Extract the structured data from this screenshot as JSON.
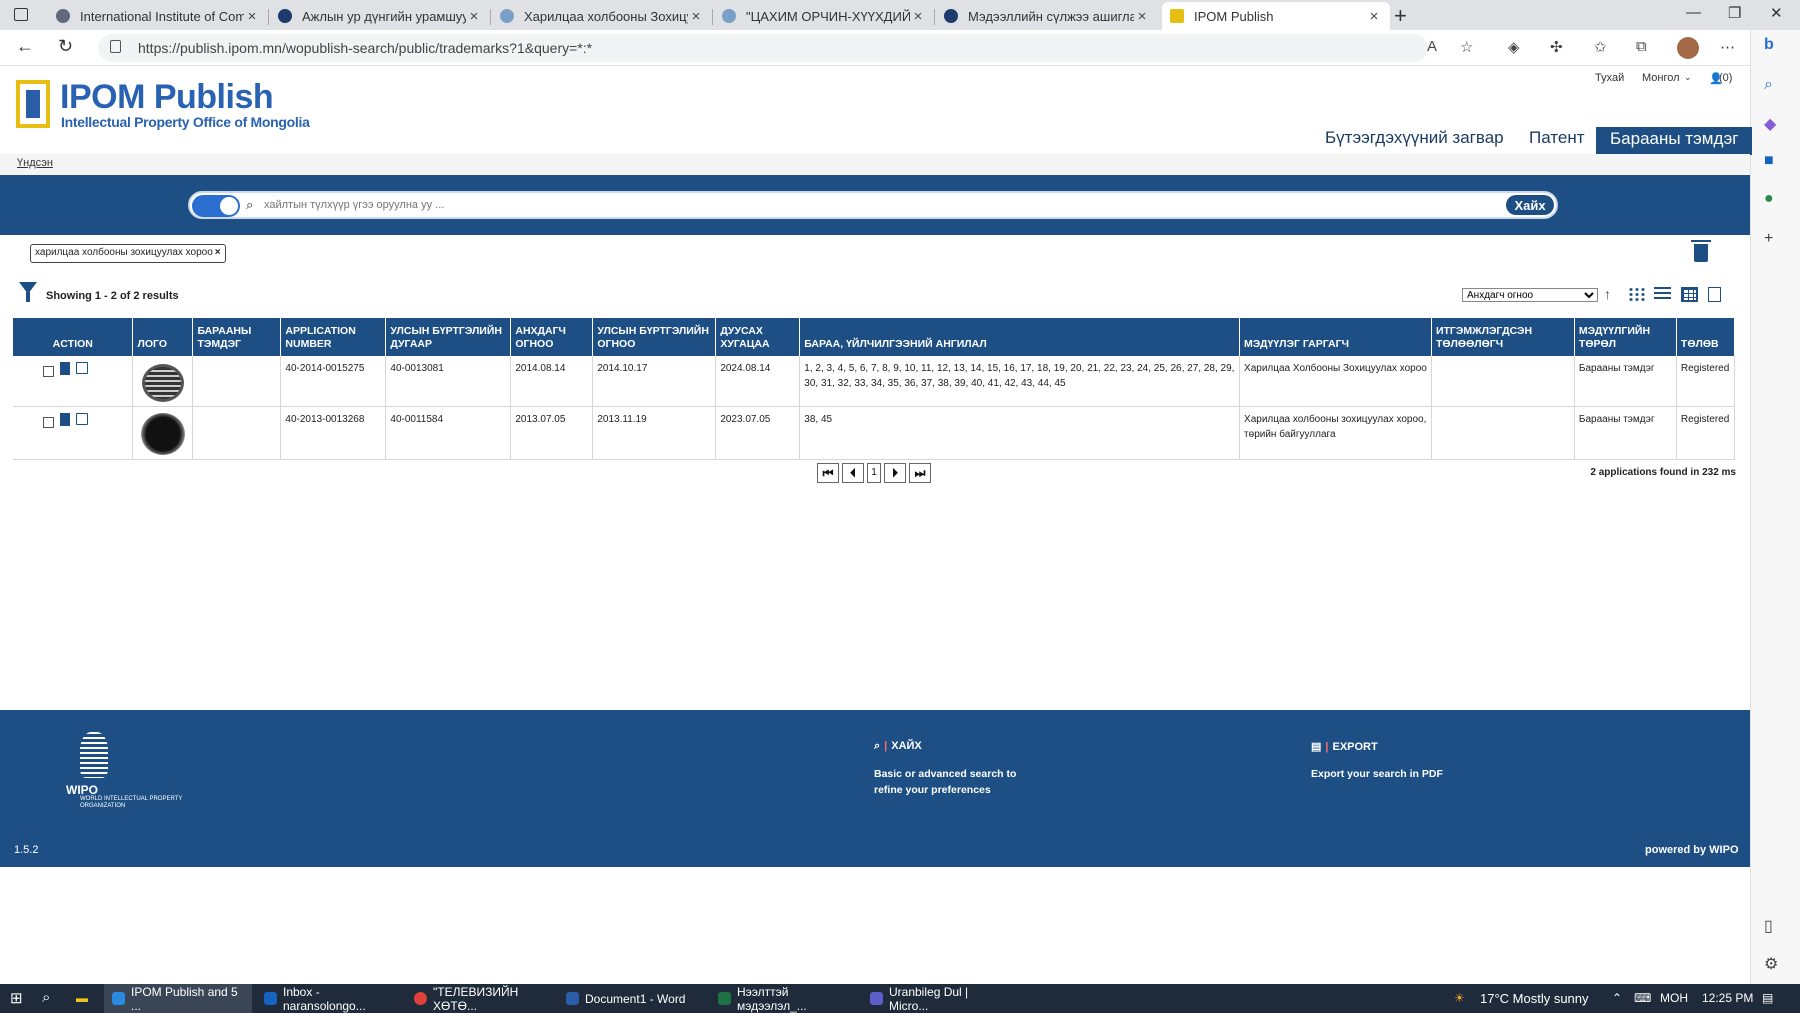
{
  "browser": {
    "tabs": [
      {
        "title": "International Institute of Commu",
        "color": "#5f6a7d"
      },
      {
        "title": "Ажлын ур дүнгийн урамшуулал",
        "color": "#1e3b6e"
      },
      {
        "title": "Харилцаа холбооны Зохицуулах",
        "color": "#7aa0c8"
      },
      {
        "title": "\"ЦАХИМ ОРЧИН-ХҮҮХДИЙН ЭР",
        "color": "#7aa0c8"
      },
      {
        "title": "Мэдээллийн сүлжээ ашиглах, үй",
        "color": "#1e3b6e"
      },
      {
        "title": "IPOM Publish",
        "color": "#e7bf12"
      }
    ],
    "url": "https://publish.ipom.mn/wopublish-search/public/trademarks?1&query=*:*"
  },
  "site": {
    "title": "IPOM Publish",
    "subtitle": "Intellectual Property Office of Mongolia",
    "top_links": {
      "about": "Тухай",
      "language": "Монгол",
      "cart": "(0)"
    },
    "nav": {
      "design": "Бүтээгдэхүүний загвар",
      "patent": "Патент",
      "trademark": "Барааны тэмдэг"
    },
    "breadcrumb": "Үндсэн"
  },
  "search": {
    "placeholder": "хайлтын түлхүүр үгээ оруулна уу ...",
    "button": "Хайх",
    "chip": "харилцаа холбооны зохицуулах хороо",
    "results": "Showing 1 - 2 of 2 results",
    "sort_option": "Анхдагч огноо"
  },
  "table": {
    "headers": {
      "action": "ACTION",
      "logo": "ЛОГО",
      "mark": "БАРААНЫ ТЭМДЭГ",
      "appno": "APPLICATION NUMBER",
      "regno": "УЛСЫН БҮРТГЭЛИЙН ДУГААР",
      "filed": "АНХДАГЧ ОГНОО",
      "regdate": "УЛСЫН БҮРТГЭЛИЙН ОГНОО",
      "expiry": "ДУУСАХ ХУГАЦАА",
      "classes": "БАРАА, ҮЙЛЧИЛГЭЭНИЙ АНГИЛАЛ",
      "applicant": "МЭДҮҮЛЭГ ГАРГАГЧ",
      "agent": "ИТГЭМЖЛЭГДСЭН ТӨЛӨӨЛӨГЧ",
      "type": "МЭДҮҮЛГИЙН ТӨРӨЛ",
      "status": "ТӨЛӨВ"
    },
    "rows": [
      {
        "appno": "40-2014-0015275",
        "regno": "40-0013081",
        "filed": "2014.08.14",
        "regdate": "2014.10.17",
        "expiry": "2024.08.14",
        "classes": "1, 2, 3, 4, 5, 6, 7, 8, 9, 10, 11, 12, 13, 14, 15, 16, 17, 18, 19, 20, 21, 22, 23, 24, 25, 26, 27, 28, 29, 30, 31, 32, 33, 34, 35, 36, 37, 38, 39, 40, 41, 42, 43, 44, 45",
        "applicant": "Харилцаа Холбооны Зохицуулах хороо",
        "agent": "",
        "type": "Барааны тэмдэг",
        "status": "Registered"
      },
      {
        "appno": "40-2013-0013268",
        "regno": "40-0011584",
        "filed": "2013.07.05",
        "regdate": "2013.11.19",
        "expiry": "2023.07.05",
        "classes": "38, 45",
        "applicant": "Харилцаа холбооны зохицуулах хороо, төрийн байгууллага",
        "agent": "",
        "type": "Барааны тэмдэг",
        "status": "Registered"
      }
    ],
    "page": "1",
    "found": "2 applications found in 232 ms"
  },
  "footer": {
    "wipo": "WIPO",
    "wipo_full": "WORLD INTELLECTUAL PROPERTY ORGANIZATION",
    "search_head": "ХАЙХ",
    "search_text": "Basic or advanced search to refine your preferences",
    "export_head": "EXPORT",
    "export_text": "Export your search in PDF",
    "version": "1.5.2",
    "powered": "powered by WIPO"
  },
  "taskbar": {
    "items": [
      {
        "label": "IPOM Publish and 5 ...",
        "color": "#2b8ae0"
      },
      {
        "label": "Inbox - naransolongo...",
        "color": "#1565c0"
      },
      {
        "label": "\"ТЕЛЕВИЗИЙН ХӨТӨ...",
        "color": "#e0413a"
      },
      {
        "label": "Document1 - Word",
        "color": "#2b5ca8"
      },
      {
        "label": "Нээлттэй мэдээлэл_...",
        "color": "#1e7145"
      },
      {
        "label": "Uranbileg Dul | Micro...",
        "color": "#5b5fc7"
      }
    ],
    "weather": "17°C  Mostly sunny",
    "lang": "МОН",
    "time": "12:25 PM"
  }
}
